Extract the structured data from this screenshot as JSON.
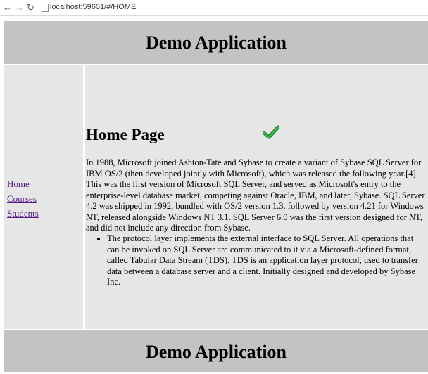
{
  "browser": {
    "back_glyph": "←",
    "forward_glyph": "→",
    "reload_glyph": "↻",
    "url": "localhost:59601/#/HOME"
  },
  "header": {
    "title": "Demo Application"
  },
  "sidebar": {
    "items": [
      {
        "label": "Home"
      },
      {
        "label": "Courses"
      },
      {
        "label": "Students"
      }
    ]
  },
  "main": {
    "title": "Home Page",
    "icon": "checkmark-icon",
    "intro": "In 1988, Microsoft joined Ashton-Tate and Sybase to create a variant of Sybase SQL Server for IBM OS/2 (then developed jointly with Microsoft), which was released the following year.[4] This was the first version of Microsoft SQL Server, and served as Microsoft's entry to the enterprise-level database market, competing against Oracle, IBM, and later, Sybase. SQL Server 4.2 was shipped in 1992, bundled with OS/2 version 1.3, followed by version 4.21 for Windows NT, released alongside Windows NT 3.1. SQL Server 6.0 was the first version designed for NT, and did not include any direction from Sybase.",
    "bullets": [
      {
        "text": "The protocol layer implements the external interface to SQL Server. All operations that can be invoked on SQL Server are communicated to it via a Microsoft-defined format, called Tabular Data Stream (TDS). TDS is an application layer protocol, used to transfer data between a database server and a client. Initially designed and developed by Sybase Inc."
      }
    ]
  },
  "footer": {
    "title": "Demo Application"
  },
  "colors": {
    "header_bg": "#c3c3c3",
    "panel_bg": "#e6e6e6",
    "link": "#551a8b",
    "check_green": "#2e9e3a"
  }
}
